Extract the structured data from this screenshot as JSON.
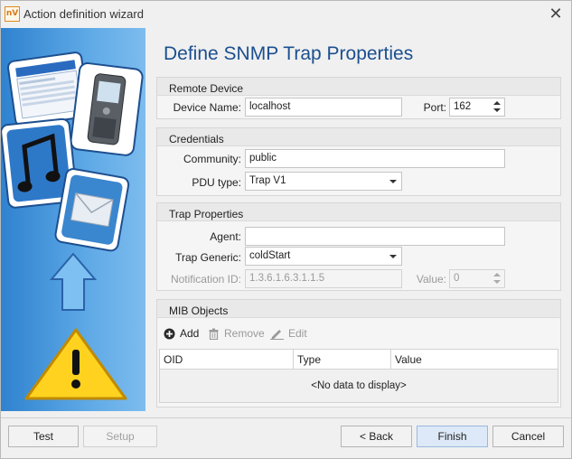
{
  "window": {
    "title": "Action definition wizard",
    "app_icon_text": "nV"
  },
  "page": {
    "heading": "Define SNMP Trap Properties"
  },
  "remote_device": {
    "header": "Remote Device",
    "device_name_label": "Device Name:",
    "device_name_value": "localhost",
    "port_label": "Port:",
    "port_value": "162"
  },
  "credentials": {
    "header": "Credentials",
    "community_label": "Community:",
    "community_value": "public",
    "pdu_type_label": "PDU type:",
    "pdu_type_value": "Trap V1"
  },
  "trap_properties": {
    "header": "Trap Properties",
    "agent_label": "Agent:",
    "agent_value": "",
    "trap_generic_label": "Trap Generic:",
    "trap_generic_value": "coldStart",
    "notification_id_label": "Notification ID:",
    "notification_id_value": "1.3.6.1.6.3.1.1.5",
    "value_label": "Value:",
    "value_value": "0"
  },
  "mib_objects": {
    "header": "MIB Objects",
    "add_label": "Add",
    "remove_label": "Remove",
    "edit_label": "Edit",
    "columns": [
      "OID",
      "Type",
      "Value"
    ],
    "empty_text": "<No data to display>"
  },
  "footer": {
    "test_label": "Test",
    "setup_label": "Setup",
    "back_label": "< Back",
    "finish_label": "Finish",
    "cancel_label": "Cancel"
  },
  "colors": {
    "heading": "#1b4f8f",
    "side_panel": "#3d8fd6",
    "primary_button": "#dde9f8"
  },
  "icons": [
    "close-icon",
    "plus-circle-icon",
    "trash-icon",
    "pencil-icon",
    "dropdown-arrow-icon",
    "spinner-icon",
    "desktop-window-icon",
    "mobile-phone-icon",
    "music-note-icon",
    "envelope-icon",
    "up-arrow-icon",
    "warning-icon"
  ]
}
